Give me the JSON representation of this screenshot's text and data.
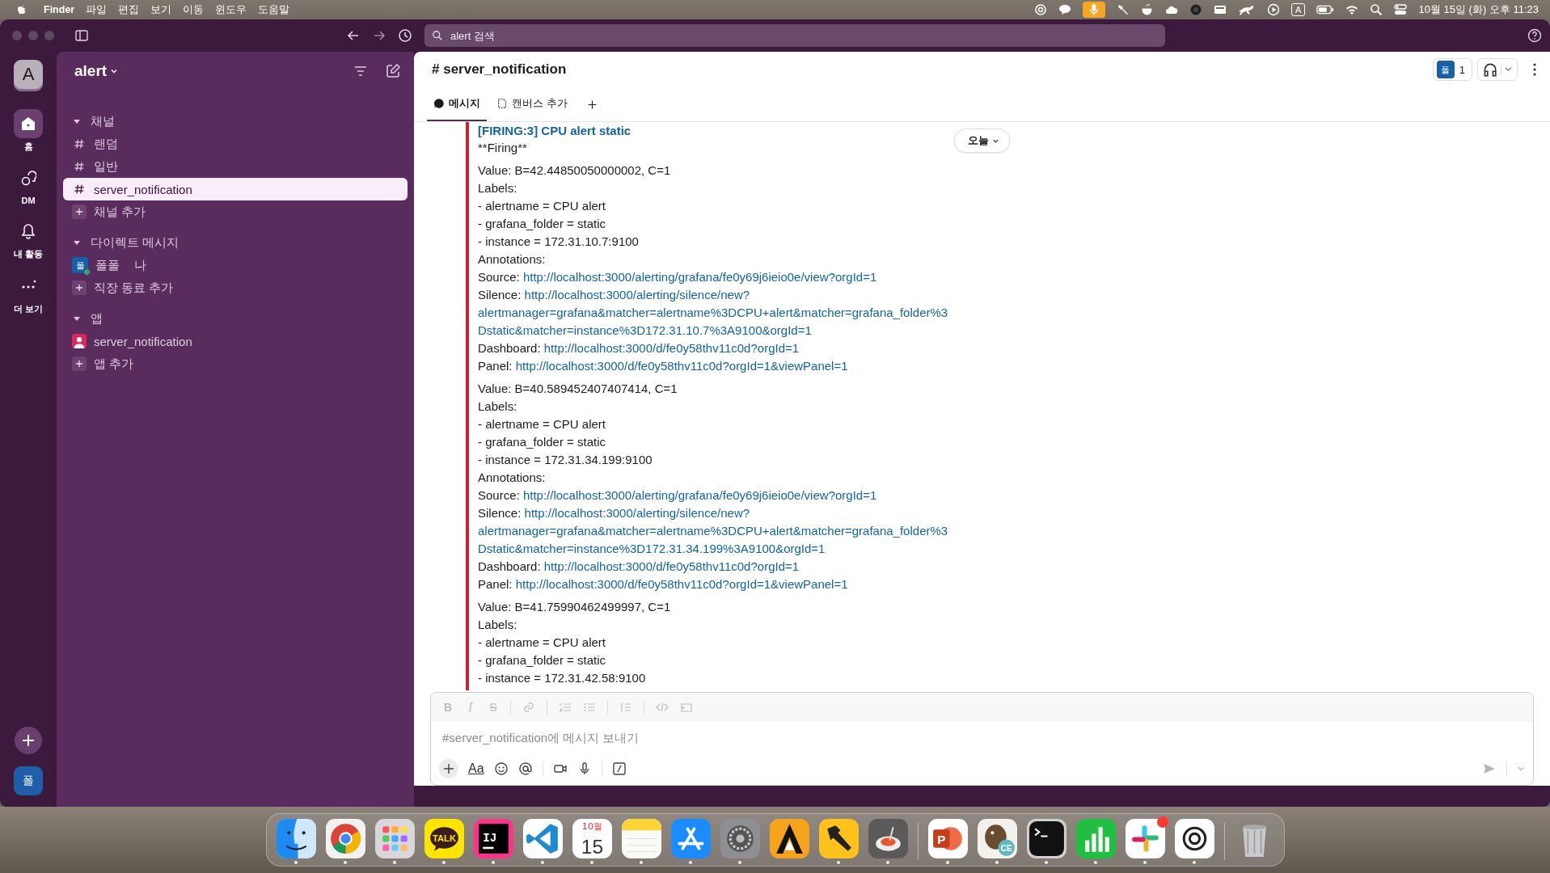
{
  "menubar": {
    "items": [
      "Finder",
      "파일",
      "편집",
      "보기",
      "이동",
      "윈도우",
      "도움말"
    ],
    "input_source": "A",
    "clock": "10월 15일 (화) 오후 11:23"
  },
  "toolbar": {
    "search": {
      "placeholder": "alert 검색"
    }
  },
  "rail": {
    "workspace": "A",
    "items": [
      {
        "kind": "home",
        "label": "홈",
        "selected": true
      },
      {
        "kind": "dm",
        "label": "DM",
        "selected": false
      },
      {
        "kind": "activity",
        "label": "내 활동",
        "selected": false
      },
      {
        "kind": "more",
        "label": "더 보기",
        "selected": false
      }
    ],
    "user": "폴"
  },
  "sidebar": {
    "workspace": "alert",
    "sections": [
      {
        "title": "채널",
        "expanded": true,
        "items": [
          {
            "kind": "channel",
            "label": "랜덤",
            "selected": false
          },
          {
            "kind": "channel",
            "label": "일반",
            "selected": false
          },
          {
            "kind": "channel",
            "label": "server_notification",
            "selected": true
          },
          {
            "kind": "add",
            "label": "채널 추가",
            "selected": false
          }
        ]
      },
      {
        "title": "다이렉트 메시지",
        "expanded": true,
        "items": [
          {
            "kind": "user",
            "avatar": "폴",
            "label": "폴폴",
            "suffix": "나",
            "selected": false
          },
          {
            "kind": "add",
            "label": "직장 동료 추가",
            "selected": false
          }
        ]
      },
      {
        "title": "앱",
        "expanded": true,
        "items": [
          {
            "kind": "app",
            "label": "server_notification",
            "selected": false
          },
          {
            "kind": "add",
            "label": "앱 추가",
            "selected": false
          }
        ]
      }
    ]
  },
  "channel": {
    "title": "# server_notification",
    "member_avatar": "폴",
    "member_count": "1",
    "tabs": [
      {
        "kind": "messages",
        "label": "메시지",
        "selected": true
      },
      {
        "kind": "canvas",
        "label": "캔버스 추가",
        "selected": false
      }
    ]
  },
  "date_pill": "오늘",
  "message": {
    "title": "[FIRING:3] CPU alert static",
    "subtitle": "**Firing**",
    "blocks": [
      {
        "lines": [
          {
            "kind": "text",
            "text": "Value: B=42.44850050000002, C=1"
          },
          {
            "kind": "text",
            "text": "Labels:"
          },
          {
            "kind": "text",
            "text": "- alertname = CPU alert"
          },
          {
            "kind": "text",
            "text": "- grafana_folder = static"
          },
          {
            "kind": "text",
            "text": "- instance = 172.31.10.7:9100"
          },
          {
            "kind": "text",
            "text": "Annotations:"
          },
          {
            "kind": "link",
            "label": "Source:",
            "link": [
              "http://localhost:3000/alerting/grafana/fe0y69j6ieio0e/view?orgId=1"
            ]
          },
          {
            "kind": "link",
            "label": "Silence:",
            "link": [
              "http://localhost:3000/alerting/silence/new?",
              "alertmanager=grafana&matcher=alertname%3DCPU+alert&matcher=grafana_folder%3",
              "Dstatic&matcher=instance%3D172.31.10.7%3A9100&orgId=1"
            ]
          },
          {
            "kind": "link",
            "label": "Dashboard:",
            "link": [
              "http://localhost:3000/d/fe0y58thv11c0d?orgId=1"
            ]
          },
          {
            "kind": "link",
            "label": "Panel:",
            "link": [
              "http://localhost:3000/d/fe0y58thv11c0d?orgId=1&viewPanel=1"
            ]
          }
        ]
      },
      {
        "lines": [
          {
            "kind": "text",
            "text": "Value: B=40.589452407407414, C=1"
          },
          {
            "kind": "text",
            "text": "Labels:"
          },
          {
            "kind": "text",
            "text": "- alertname = CPU alert"
          },
          {
            "kind": "text",
            "text": "- grafana_folder = static"
          },
          {
            "kind": "text",
            "text": "- instance = 172.31.34.199:9100"
          },
          {
            "kind": "text",
            "text": "Annotations:"
          },
          {
            "kind": "link",
            "label": "Source:",
            "link": [
              "http://localhost:3000/alerting/grafana/fe0y69j6ieio0e/view?orgId=1"
            ]
          },
          {
            "kind": "link",
            "label": "Silence:",
            "link": [
              "http://localhost:3000/alerting/silence/new?",
              "alertmanager=grafana&matcher=alertname%3DCPU+alert&matcher=grafana_folder%3",
              "Dstatic&matcher=instance%3D172.31.34.199%3A9100&orgId=1"
            ]
          },
          {
            "kind": "link",
            "label": "Dashboard:",
            "link": [
              "http://localhost:3000/d/fe0y58thv11c0d?orgId=1"
            ]
          },
          {
            "kind": "link",
            "label": "Panel:",
            "link": [
              "http://localhost:3000/d/fe0y58thv11c0d?orgId=1&viewPanel=1"
            ]
          }
        ]
      },
      {
        "lines": [
          {
            "kind": "text",
            "text": "Value: B=41.75990462499997, C=1"
          },
          {
            "kind": "text",
            "text": "Labels:"
          },
          {
            "kind": "text",
            "text": "- alertname = CPU alert"
          },
          {
            "kind": "text",
            "text": "- grafana_folder = static"
          },
          {
            "kind": "text",
            "text": "- instance = 172.31.42.58:9100"
          }
        ]
      }
    ]
  },
  "composer": {
    "format_letters": [
      "B",
      "I",
      "S"
    ],
    "placeholder": "#server_notification에 메시지 보내기",
    "text_style": "Aa"
  },
  "dock": [
    {
      "kind": "finder",
      "running": true
    },
    {
      "kind": "chrome",
      "running": true
    },
    {
      "kind": "launchpad",
      "running": true
    },
    {
      "kind": "kakaotalk",
      "label": "TALK",
      "running": true
    },
    {
      "kind": "intellij",
      "label": "IJ",
      "running": true
    },
    {
      "kind": "vscode",
      "running": true
    },
    {
      "kind": "calendar",
      "label": "10월",
      "sublabel": "15",
      "running": true
    },
    {
      "kind": "notes",
      "running": true
    },
    {
      "kind": "appstore",
      "running": true
    },
    {
      "kind": "settings",
      "running": true
    },
    {
      "kind": "triangle",
      "running": false
    },
    {
      "kind": "hammer",
      "running": true
    },
    {
      "kind": "plate",
      "running": true
    },
    {
      "kind": "separator"
    },
    {
      "kind": "powerpoint",
      "label": "P",
      "running": true
    },
    {
      "kind": "beaver",
      "label": "CE",
      "running": true
    },
    {
      "kind": "terminal",
      "running": true
    },
    {
      "kind": "numbers",
      "running": true
    },
    {
      "kind": "slack",
      "running": true,
      "badge": true
    },
    {
      "kind": "chatgpt",
      "running": true
    },
    {
      "kind": "separator"
    },
    {
      "kind": "trash",
      "running": false
    }
  ]
}
